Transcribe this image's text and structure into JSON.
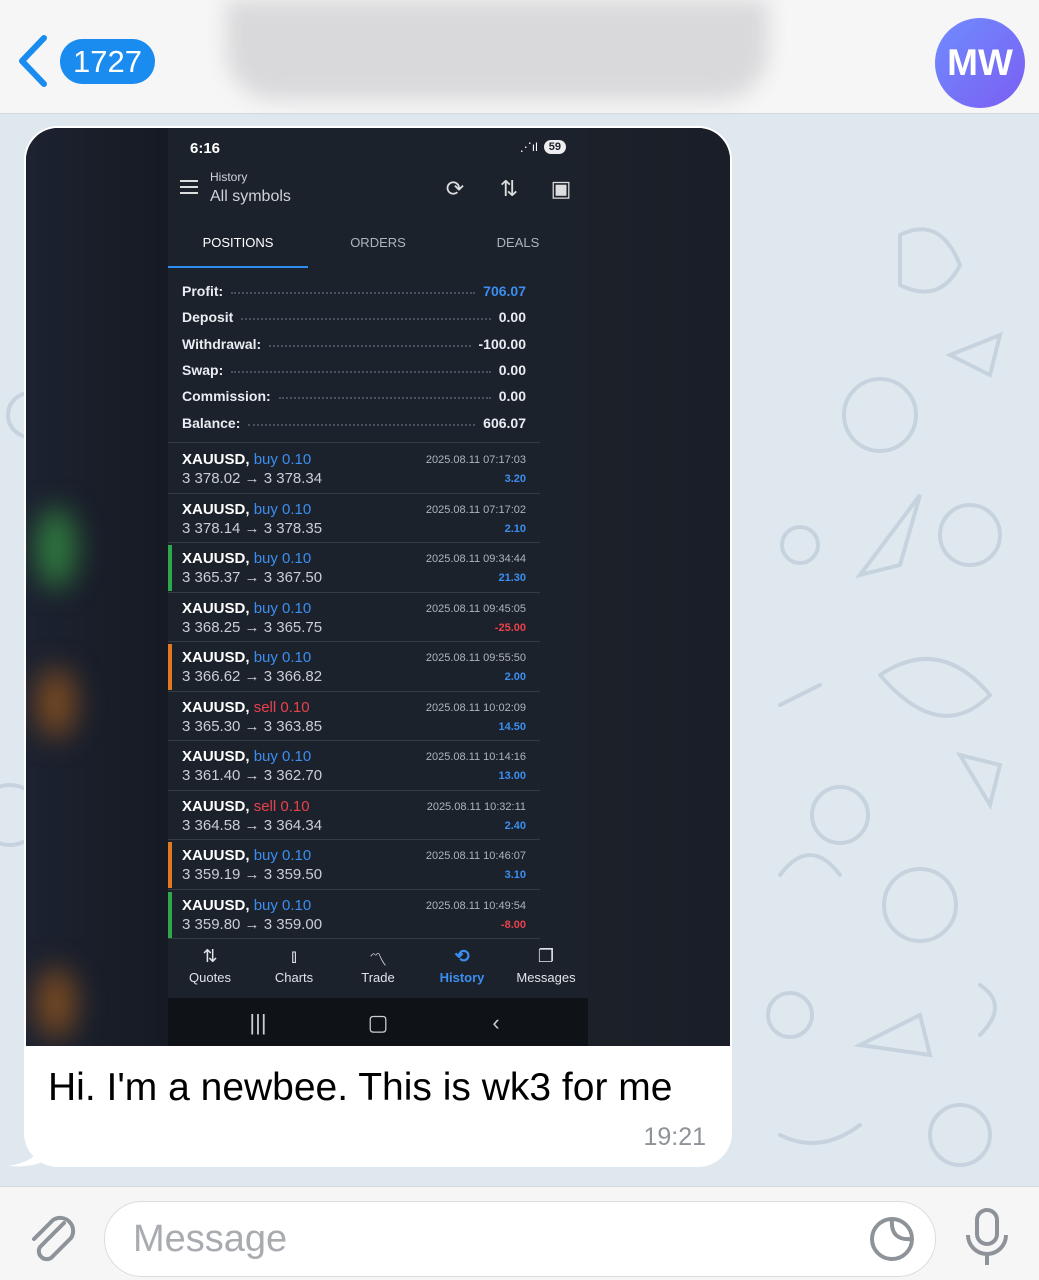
{
  "header": {
    "back_count": "1727",
    "avatar_initials": "MW"
  },
  "message": {
    "caption": "Hi. I'm a newbee. This is wk3 for me",
    "time": "19:21"
  },
  "phone": {
    "status_time": "6:16",
    "battery": "59",
    "title": "History",
    "subtitle": "All symbols",
    "tabs": [
      "POSITIONS",
      "ORDERS",
      "DEALS"
    ],
    "summary": [
      {
        "label": "Profit:",
        "value": "706.07",
        "color": "#3b8ef0"
      },
      {
        "label": "Deposit",
        "value": "0.00",
        "color": "#ffffff"
      },
      {
        "label": "Withdrawal:",
        "value": "-100.00",
        "color": "#ffffff"
      },
      {
        "label": "Swap:",
        "value": "0.00",
        "color": "#ffffff"
      },
      {
        "label": "Commission:",
        "value": "0.00",
        "color": "#ffffff"
      },
      {
        "label": "Balance:",
        "value": "606.07",
        "color": "#ffffff"
      }
    ],
    "trades": [
      {
        "symbol": "XAUUSD,",
        "side": "buy",
        "volume": "0.10",
        "prices": "3 378.02 → 3 378.34",
        "date": "2025.08.11 07:17:03",
        "pl": "3.20",
        "marker": ""
      },
      {
        "symbol": "XAUUSD,",
        "side": "buy",
        "volume": "0.10",
        "prices": "3 378.14 → 3 378.35",
        "date": "2025.08.11 07:17:02",
        "pl": "2.10",
        "marker": ""
      },
      {
        "symbol": "XAUUSD,",
        "side": "buy",
        "volume": "0.10",
        "prices": "3 365.37 → 3 367.50",
        "date": "2025.08.11 09:34:44",
        "pl": "21.30",
        "marker": "#2ea84a"
      },
      {
        "symbol": "XAUUSD,",
        "side": "buy",
        "volume": "0.10",
        "prices": "3 368.25 → 3 365.75",
        "date": "2025.08.11 09:45:05",
        "pl": "-25.00",
        "marker": ""
      },
      {
        "symbol": "XAUUSD,",
        "side": "buy",
        "volume": "0.10",
        "prices": "3 366.62 → 3 366.82",
        "date": "2025.08.11 09:55:50",
        "pl": "2.00",
        "marker": "#e07a22"
      },
      {
        "symbol": "XAUUSD,",
        "side": "sell",
        "volume": "0.10",
        "prices": "3 365.30 → 3 363.85",
        "date": "2025.08.11 10:02:09",
        "pl": "14.50",
        "marker": ""
      },
      {
        "symbol": "XAUUSD,",
        "side": "buy",
        "volume": "0.10",
        "prices": "3 361.40 → 3 362.70",
        "date": "2025.08.11 10:14:16",
        "pl": "13.00",
        "marker": ""
      },
      {
        "symbol": "XAUUSD,",
        "side": "sell",
        "volume": "0.10",
        "prices": "3 364.58 → 3 364.34",
        "date": "2025.08.11 10:32:11",
        "pl": "2.40",
        "marker": ""
      },
      {
        "symbol": "XAUUSD,",
        "side": "buy",
        "volume": "0.10",
        "prices": "3 359.19 → 3 359.50",
        "date": "2025.08.11 10:46:07",
        "pl": "3.10",
        "marker": "#e07a22"
      },
      {
        "symbol": "XAUUSD,",
        "side": "buy",
        "volume": "0.10",
        "prices": "3 359.80 → 3 359.00",
        "date": "2025.08.11 10:49:54",
        "pl": "-8.00",
        "marker": "#2ea84a"
      }
    ],
    "nav": [
      {
        "label": "Quotes",
        "icon": "quotes-icon",
        "glyph": "⇅",
        "active": false
      },
      {
        "label": "Charts",
        "icon": "charts-icon",
        "glyph": "⫾",
        "active": false
      },
      {
        "label": "Trade",
        "icon": "trade-icon",
        "glyph": "〽",
        "active": false
      },
      {
        "label": "History",
        "icon": "history-icon",
        "glyph": "⟲",
        "active": true
      },
      {
        "label": "Messages",
        "icon": "messages-icon",
        "glyph": "❐",
        "active": false
      }
    ]
  },
  "input": {
    "placeholder": "Message"
  },
  "colors": {
    "accent": "#1a8cf0",
    "buy": "#3b8ef0",
    "sell": "#e9414b"
  }
}
